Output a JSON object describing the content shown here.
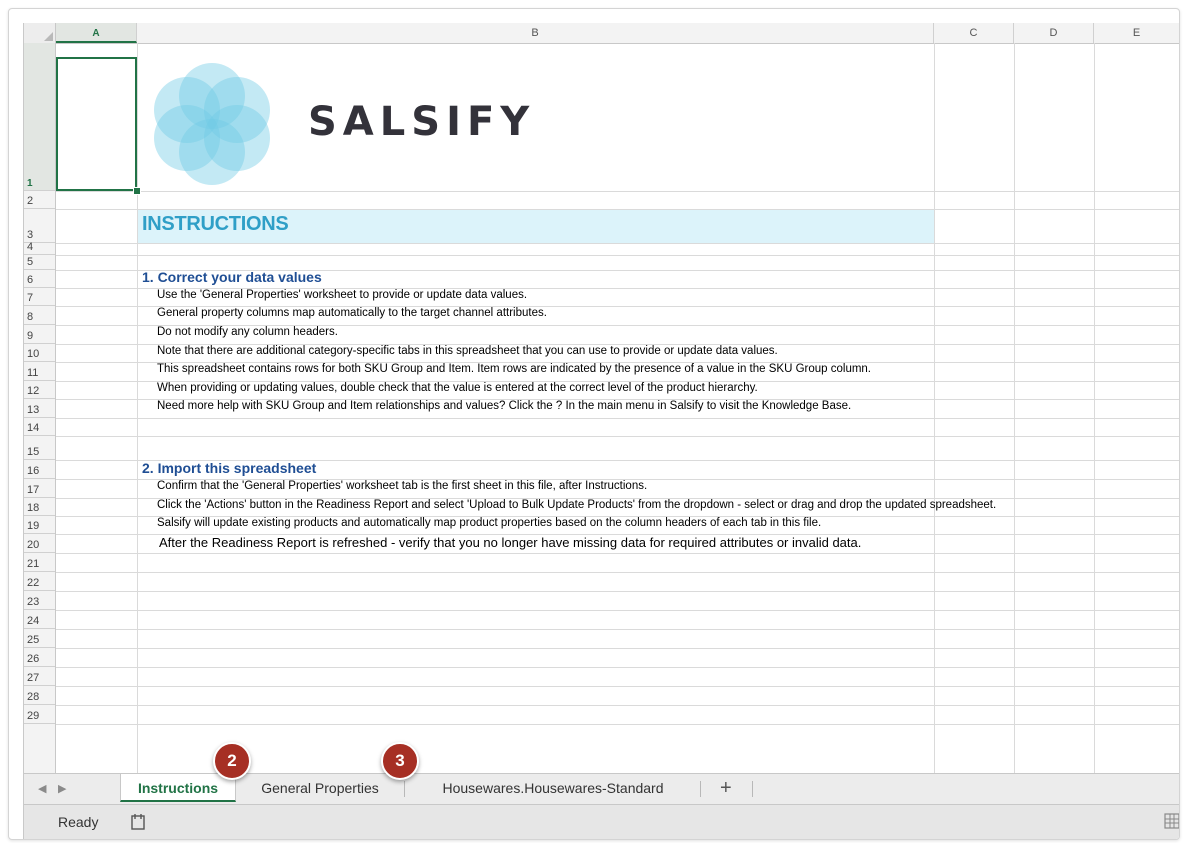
{
  "columns": [
    "A",
    "B",
    "C",
    "D",
    "E"
  ],
  "rows": [
    "1",
    "2",
    "3",
    "4",
    "5",
    "6",
    "7",
    "8",
    "9",
    "10",
    "11",
    "12",
    "13",
    "14",
    "15",
    "16",
    "17",
    "18",
    "19",
    "20",
    "21",
    "22",
    "23",
    "24",
    "25",
    "26",
    "27",
    "28",
    "29"
  ],
  "logo": {
    "text": "SALSIFY",
    "color": "#6fcbe4"
  },
  "instructions_title": "INSTRUCTIONS",
  "section1": {
    "heading": "1. Correct your data values",
    "lines": [
      "Use the 'General Properties' worksheet to provide or update data values.",
      "General property columns map automatically to the target channel attributes.",
      "Do not modify any column headers.",
      "Note that there are additional category-specific tabs in this spreadsheet that you can use to provide or update data values.",
      "This spreadsheet contains rows for both SKU Group and Item. Item rows are indicated by the presence of a value in the SKU Group column.",
      "When providing or updating values, double check that the value is entered at the correct level of the product hierarchy.",
      "Need more help with SKU Group and Item relationships and values? Click the ? In the main menu in Salsify to visit the Knowledge Base."
    ]
  },
  "section2": {
    "heading": "2. Import this spreadsheet",
    "lines": [
      "Confirm that the 'General Properties' worksheet tab is the first sheet in this file, after Instructions.",
      "Click the 'Actions' button in the Readiness Report and select 'Upload to Bulk Update Products' from the dropdown  - select or drag and drop the updated spreadsheet.",
      "Salsify will update existing products and automatically map product properties based on the column headers of each tab in this file.",
      "After the Readiness Report is refreshed -  verify that you no longer have missing data for required attributes or invalid data."
    ]
  },
  "tabs": [
    "Instructions",
    "General Properties",
    "Housewares.Housewares-Standard"
  ],
  "add_tab_label": "+",
  "nav": {
    "prev": "◀",
    "next": "▶"
  },
  "status": "Ready",
  "badges": [
    "2",
    "3"
  ],
  "colors": {
    "accent": "#217346",
    "banner": "#dcf3fa",
    "heading": "#1f4e94",
    "title": "#2f9fc7",
    "badge": "#a62f24"
  }
}
